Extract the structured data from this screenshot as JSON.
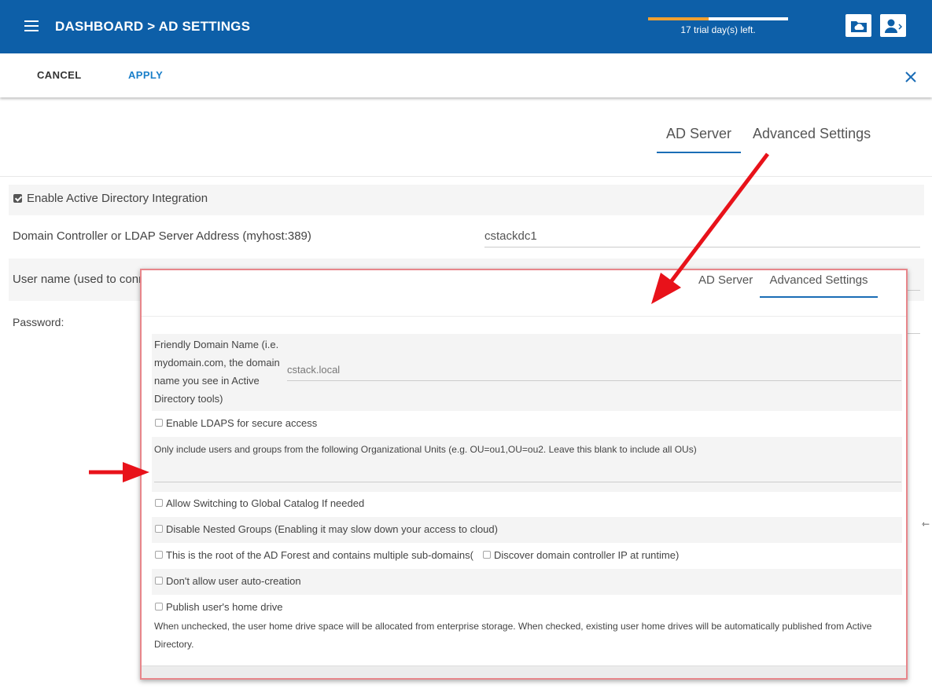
{
  "header": {
    "breadcrumb": "DASHBOARD > AD SETTINGS",
    "trial_text": "17 trial day(s) left.",
    "trial_progress_fraction": 0.43,
    "icons": [
      "menu-icon",
      "cloud-folder-icon",
      "user-logout-icon"
    ]
  },
  "toolbar": {
    "cancel_label": "CANCEL",
    "apply_label": "APPLY"
  },
  "main": {
    "tabs": [
      {
        "label": "AD Server",
        "active": true
      },
      {
        "label": "Advanced Settings",
        "active": false
      }
    ],
    "enable_ad_label": "Enable Active Directory Integration",
    "enable_ad_checked": true,
    "domain_controller_label": "Domain Controller or LDAP Server Address (myhost:389)",
    "domain_controller_value": "cstackdc1",
    "username_label_visible": "User name (used to conn",
    "password_label": "Password:"
  },
  "popup": {
    "tabs": [
      {
        "label": "AD Server",
        "active": false
      },
      {
        "label": "Advanced Settings",
        "active": true
      }
    ],
    "friendly_domain_label_lines": [
      "Friendly Domain Name (i.e.",
      "mydomain.com, the domain",
      "name you see in Active",
      "Directory tools)"
    ],
    "friendly_domain_value": "cstack.local",
    "ldaps_label": "Enable LDAPS for secure access",
    "ou_label": "Only include users and groups from the following Organizational Units (e.g. OU=ou1,OU=ou2. Leave this blank to include all OUs)",
    "ou_value": "",
    "global_catalog_label": "Allow Switching to Global Catalog If needed",
    "nested_groups_label": "Disable Nested Groups (Enabling it may slow down your access to cloud)",
    "forest_root_label": "This is the root of the AD Forest and contains multiple sub-domains(",
    "discover_dc_label": "Discover domain controller IP at runtime)",
    "no_autocreate_label": "Don't allow user auto-creation",
    "home_drive_label": "Publish user's home drive",
    "home_drive_desc_line1": "When unchecked, the user home drive space will be allocated from enterprise storage. When checked, existing user home drives will be automatically published from Active",
    "home_drive_desc_line2": "Directory."
  },
  "colors": {
    "header_bg": "#0d5fa8",
    "accent_blue": "#1a7fc9",
    "annotation_red": "#e8121a",
    "popup_border": "#e8868b"
  }
}
